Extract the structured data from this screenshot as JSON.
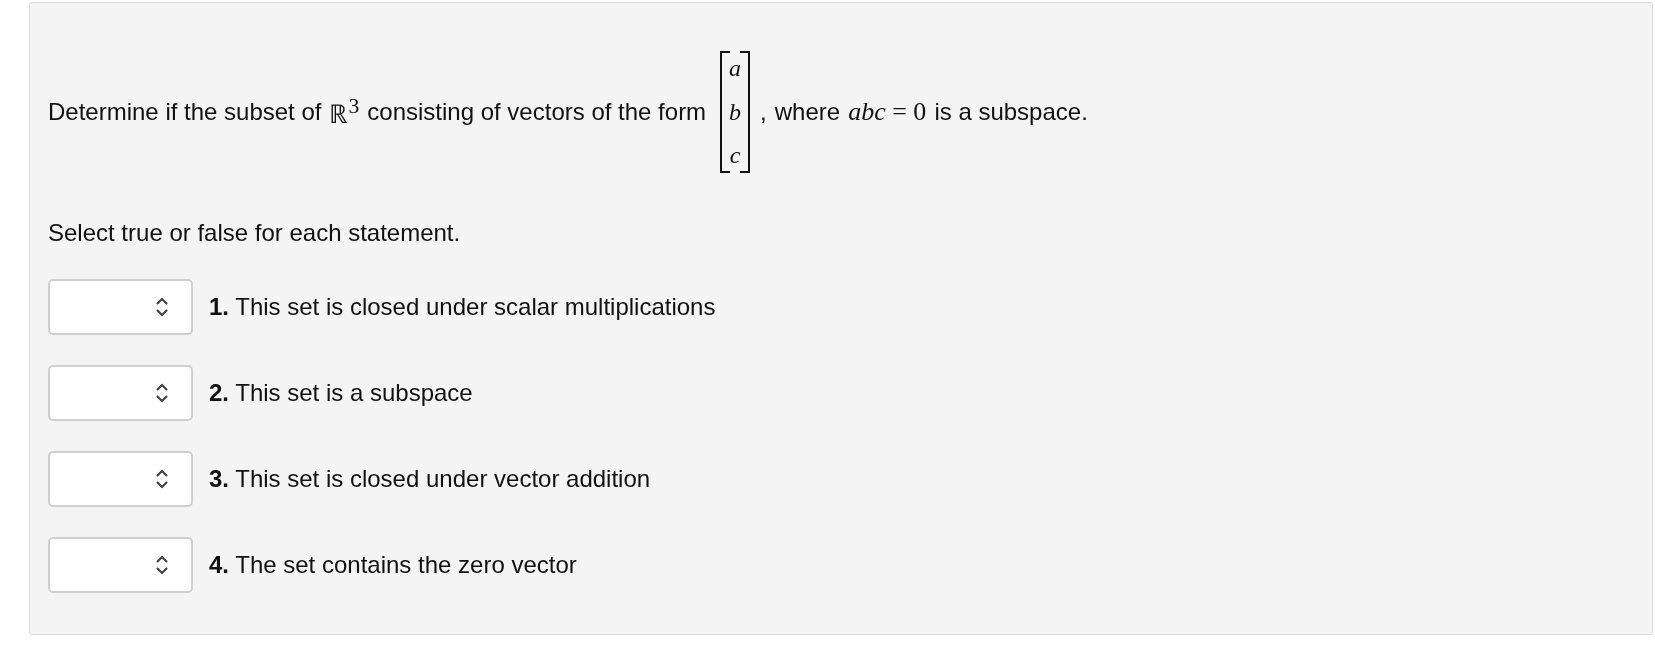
{
  "question": {
    "text_before": "Determine if the subset of",
    "set_symbol": "ℝ$^{3}$",
    "text_middle": "consisting of vectors of the form",
    "vector": [
      "a",
      "b",
      "c"
    ],
    "comma": ",",
    "text_where": "where",
    "condition": "*abc* = 0",
    "text_after": "is a subspace."
  },
  "instruction": "Select true or false for each statement.",
  "statements": [
    {
      "label": "**1.** This set is closed under scalar multiplications"
    },
    {
      "label": "**2.** This set is a subspace"
    },
    {
      "label": "**3.** This set is closed under vector addition"
    },
    {
      "label": "**4.** The set contains the zero vector"
    }
  ]
}
